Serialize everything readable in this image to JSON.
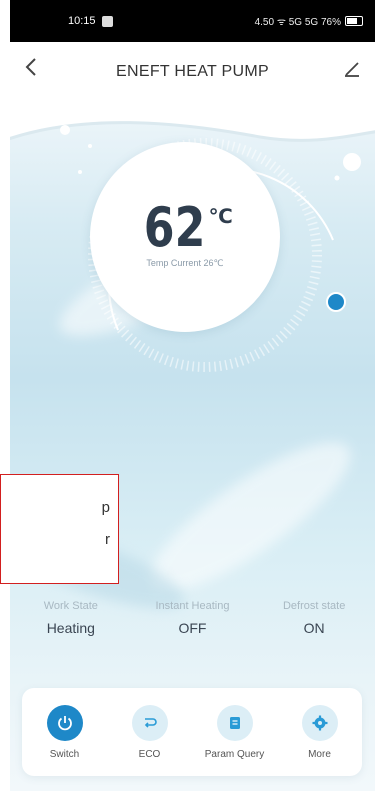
{
  "status_bar": {
    "time": "10:15",
    "right_text": "4.50 ᯤ 5G 5G 76%"
  },
  "header": {
    "title": "ENEFT HEAT PUMP",
    "back_icon": "chevron-left-icon",
    "edit_icon": "edit-icon"
  },
  "dial": {
    "temperature": "62",
    "unit": "℃",
    "subtitle": "Temp Current 26℃"
  },
  "annotation": {
    "fragment_1": "p",
    "fragment_2": "r"
  },
  "states": [
    {
      "label": "Work State",
      "value": "Heating"
    },
    {
      "label": "Instant Heating",
      "value": "OFF"
    },
    {
      "label": "Defrost state",
      "value": "ON"
    }
  ],
  "actions": [
    {
      "label": "Switch",
      "icon": "power-icon",
      "color": "#1e88c8"
    },
    {
      "label": "ECO",
      "icon": "eco-icon",
      "color": "#dceef6"
    },
    {
      "label": "Param Query",
      "icon": "document-icon",
      "color": "#dceef6"
    },
    {
      "label": "More",
      "icon": "gear-icon",
      "color": "#dceef6"
    }
  ],
  "colors": {
    "accent": "#1e88c8",
    "annotation_border": "#d21f1f",
    "text_dark": "#2f3d4d"
  }
}
